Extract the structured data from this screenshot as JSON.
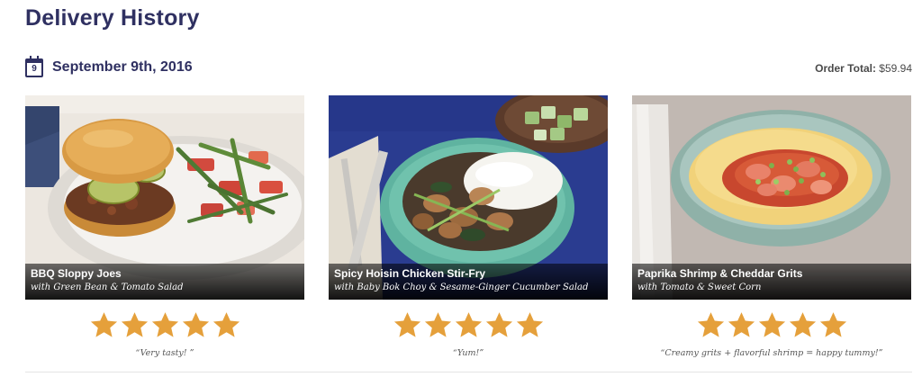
{
  "page": {
    "title": "Delivery History"
  },
  "order": {
    "calendar_day": "9",
    "date": "September 9th, 2016",
    "total_label": "Order Total:",
    "total_value": "$59.94"
  },
  "meals": [
    {
      "title": "BBQ Sloppy Joes",
      "subtitle": "with Green Bean & Tomato Salad",
      "rating": 5,
      "rating_max": 5,
      "review": "“Very tasty! ”"
    },
    {
      "title": "Spicy Hoisin Chicken Stir-Fry",
      "subtitle": "with Baby Bok Choy & Sesame-Ginger Cucumber Salad",
      "rating": 5,
      "rating_max": 5,
      "review": "“Yum!”"
    },
    {
      "title": "Paprika Shrimp & Cheddar Grits",
      "subtitle": "with Tomato & Sweet Corn",
      "rating": 5,
      "rating_max": 5,
      "review": "“Creamy grits + flavorful shrimp = happy tummy!”"
    }
  ],
  "colors": {
    "heading": "#2f3061",
    "star": "#e5a03b",
    "caption_bg": "#000000"
  },
  "icons": {
    "calendar": "calendar-icon",
    "star": "star-icon"
  }
}
